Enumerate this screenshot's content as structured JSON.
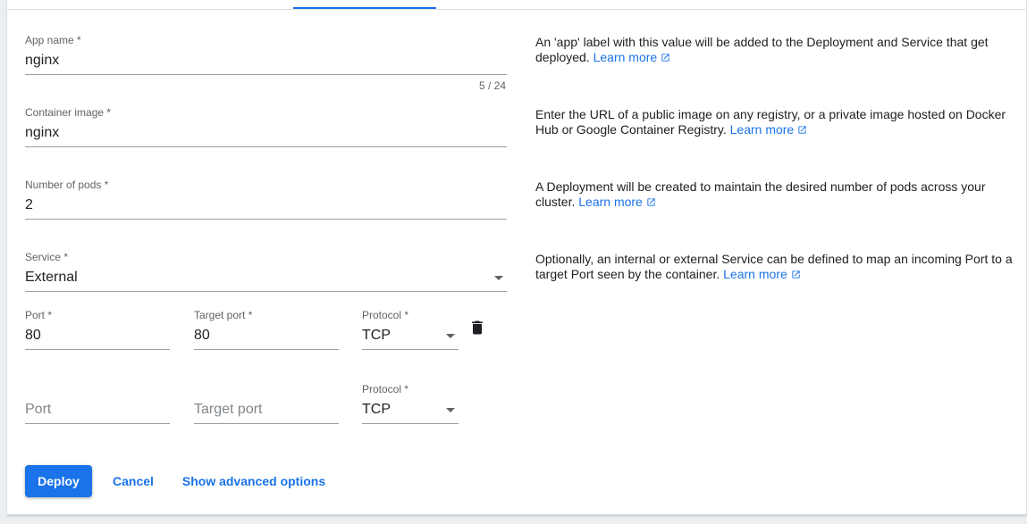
{
  "form": {
    "app_name": {
      "label": "App name *",
      "value": "nginx",
      "counter": "5 / 24"
    },
    "container_image": {
      "label": "Container image *",
      "value": "nginx"
    },
    "num_pods": {
      "label": "Number of pods *",
      "value": "2"
    },
    "service": {
      "label": "Service *",
      "value": "External"
    },
    "port_rows": [
      {
        "port": {
          "label": "Port *",
          "value": "80"
        },
        "target_port": {
          "label": "Target port *",
          "value": "80"
        },
        "protocol": {
          "label": "Protocol *",
          "value": "TCP"
        }
      },
      {
        "port": {
          "placeholder": "Port"
        },
        "target_port": {
          "placeholder": "Target port"
        },
        "protocol": {
          "label": "Protocol *",
          "value": "TCP"
        }
      }
    ]
  },
  "help": {
    "app_name": {
      "text": "An 'app' label with this value will be added to the Deployment and Service that get deployed.",
      "link": "Learn more"
    },
    "container_image": {
      "text": "Enter the URL of a public image on any registry, or a private image hosted on Docker Hub or Google Container Registry.",
      "link": "Learn more"
    },
    "num_pods": {
      "text": "A Deployment will be created to maintain the desired number of pods across your cluster.",
      "link": "Learn more"
    },
    "service": {
      "text": "Optionally, an internal or external Service can be defined to map an incoming Port to a target Port seen by the container.",
      "link": "Learn more"
    }
  },
  "actions": {
    "deploy": "Deploy",
    "cancel": "Cancel",
    "advanced": "Show advanced options"
  },
  "icons": {
    "delete": "trash-icon",
    "external_link": "open-in-new-icon",
    "dropdown": "arrow-drop-down-icon"
  },
  "colors": {
    "accent": "#1a73e8",
    "text": "#202124",
    "label": "#5f6368",
    "underline": "#9aa0a6"
  }
}
